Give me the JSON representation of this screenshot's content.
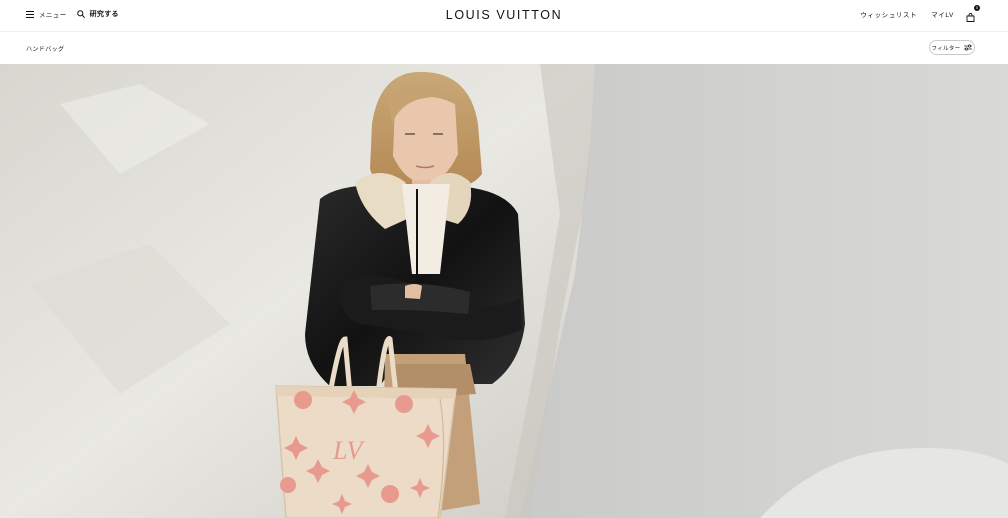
{
  "header": {
    "menu_label": "メニュー",
    "search_label": "研究する",
    "logo": "LOUIS VUITTON",
    "wishlist_label": "ウィッシュリスト",
    "account_label": "マイLV",
    "bag_count": "0"
  },
  "subbar": {
    "breadcrumb": "ハンドバッグ",
    "filter_label": "フィルター"
  },
  "hero": {
    "image": "model-with-monogram-tote-photo"
  },
  "colors": {
    "text": "#19110b",
    "divider": "#eeeeee",
    "tote_cream": "#ecdcc7",
    "tote_pink": "#e89a8f"
  }
}
